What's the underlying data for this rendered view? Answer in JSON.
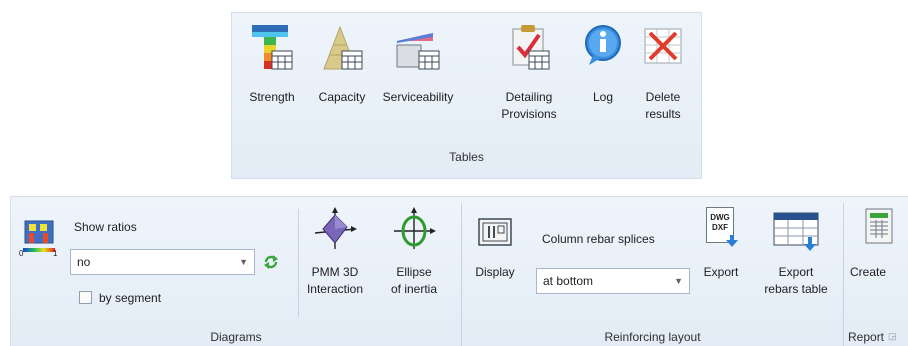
{
  "tables_panel": {
    "buttons": [
      {
        "label": "Strength",
        "icon": "strength-table-icon"
      },
      {
        "label": "Capacity",
        "icon": "capacity-table-icon"
      },
      {
        "label": "Serviceability",
        "icon": "serviceability-table-icon"
      },
      {
        "label": "Detailing\nProvisions",
        "icon": "detailing-provisions-icon"
      },
      {
        "label": "Log",
        "icon": "info-log-icon"
      },
      {
        "label": "Delete\nresults",
        "icon": "delete-results-icon"
      }
    ],
    "group_label": "Tables"
  },
  "diagrams": {
    "ratio_icon": "ratio-colormap-icon",
    "scale_min": "0",
    "scale_max": "1",
    "show_ratios_label": "Show ratios",
    "show_ratios_value": "no",
    "refresh_icon": "refresh-icon",
    "by_segment_label": "by segment",
    "by_segment_checked": false,
    "pmm_label": "PMM 3D\nInteraction",
    "ellipse_label": "Ellipse\nof inertia",
    "group_label": "Diagrams"
  },
  "reinforcing": {
    "display_label": "Display",
    "splices_label": "Column rebar splices",
    "splices_value": "at bottom",
    "export_label": "Export",
    "export_icon_text_1": "DWG",
    "export_icon_text_2": "DXF",
    "export_rebars_label": "Export\nrebars table",
    "group_label": "Reinforcing layout"
  },
  "report": {
    "create_label": "Create",
    "group_label": "Report"
  },
  "colors": {
    "ribbon_bg": "#e8f0f8",
    "accent_blue": "#2a7fd4",
    "delete_red": "#e03c2a",
    "refresh_green": "#3aa43a"
  }
}
